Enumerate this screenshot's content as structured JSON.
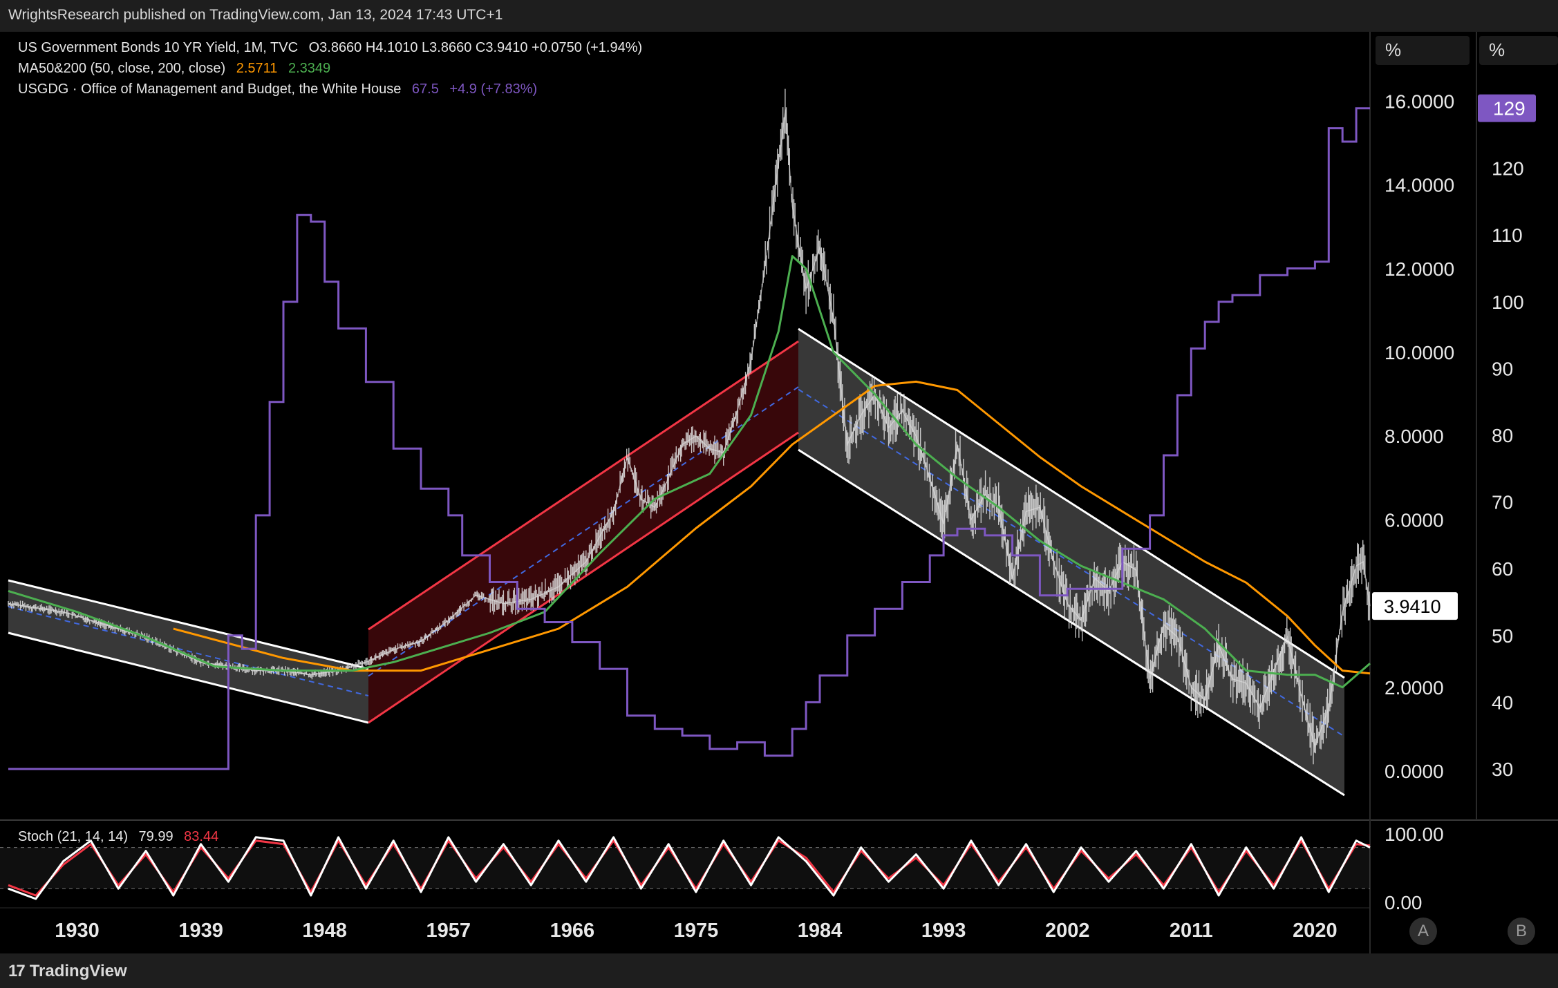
{
  "header": {
    "publisher": "WrightsResearch published on TradingView.com, Jan 13, 2024 17:43 UTC+1"
  },
  "legend": {
    "symbol": "US Government Bonds 10 YR Yield, 1M, TVC",
    "ohlc": "O3.8660   H4.1010   L3.8660   C3.9410   +0.0750 (+1.94%)",
    "ma_label": "MA50&200 (50, close, 200, close)",
    "ma50_value": "2.5711",
    "ma200_value": "2.3349",
    "debt_label": "USGDG · Office of Management and Budget, the White House",
    "debt_value": "67.5",
    "debt_change": "+4.9 (+7.83%)",
    "stoch_label": "Stoch (21, 14, 14)",
    "stoch_k": "79.99",
    "stoch_d": "83.44"
  },
  "price_scale": {
    "unit": "%",
    "ticks": [
      "16.0000",
      "14.0000",
      "12.0000",
      "10.0000",
      "8.0000",
      "6.0000",
      "2.0000",
      "0.0000"
    ],
    "last_price": "3.9410"
  },
  "debt_scale": {
    "unit": "%",
    "ticks": [
      "120",
      "110",
      "100",
      "90",
      "80",
      "70",
      "60",
      "50",
      "40",
      "30"
    ],
    "last_value": "129"
  },
  "stoch_scale": {
    "ticks": [
      "100.00",
      "0.00"
    ]
  },
  "time_axis": {
    "ticks": [
      "1930",
      "1939",
      "1948",
      "1957",
      "1966",
      "1975",
      "1984",
      "1993",
      "2002",
      "2011",
      "2020"
    ]
  },
  "buttons": {
    "a": "A",
    "b": "B"
  },
  "footer": {
    "brand": "TradingView"
  },
  "colors": {
    "debt": "#7e57c2",
    "ma50": "#4caf50",
    "ma200": "#ff9800",
    "price": "#e0e0e0",
    "channel_up": "#f23645",
    "channel_down": "#ffffff",
    "stoch_k": "#ffffff",
    "stoch_d": "#f23645"
  },
  "chart_data": [
    {
      "type": "line",
      "name": "US Government Bonds 10 YR Yield",
      "x": [
        1925,
        1927,
        1929,
        1931,
        1933,
        1935,
        1937,
        1939,
        1941,
        1943,
        1945,
        1947,
        1949,
        1951,
        1953,
        1955,
        1957,
        1959,
        1961,
        1963,
        1965,
        1967,
        1969,
        1970,
        1971,
        1972,
        1973,
        1974,
        1975,
        1976,
        1977,
        1978,
        1979,
        1980,
        1981,
        1981.5,
        1982,
        1983,
        1984,
        1985,
        1986,
        1987,
        1988,
        1989,
        1990,
        1991,
        1992,
        1993,
        1994,
        1995,
        1996,
        1997,
        1998,
        1999,
        2000,
        2001,
        2002,
        2003,
        2004,
        2005,
        2006,
        2007,
        2008,
        2009,
        2010,
        2011,
        2012,
        2013,
        2014,
        2015,
        2016,
        2017,
        2018,
        2019,
        2020,
        2021,
        2022,
        2023,
        2023.5,
        2024
      ],
      "y": [
        4.0,
        3.9,
        3.8,
        3.6,
        3.4,
        3.2,
        2.9,
        2.6,
        2.5,
        2.4,
        2.4,
        2.3,
        2.4,
        2.6,
        2.9,
        3.1,
        3.6,
        4.2,
        4.0,
        4.1,
        4.4,
        5.0,
        6.2,
        7.5,
        6.5,
        6.3,
        7.0,
        7.8,
        8.0,
        7.7,
        7.6,
        8.6,
        9.8,
        12.0,
        14.5,
        15.8,
        13.5,
        11.5,
        12.5,
        10.8,
        7.8,
        8.5,
        9.0,
        8.2,
        8.6,
        8.0,
        7.0,
        5.9,
        7.8,
        6.0,
        6.6,
        6.3,
        4.6,
        6.2,
        6.3,
        5.0,
        4.0,
        3.6,
        4.6,
        4.3,
        5.0,
        4.8,
        2.2,
        3.5,
        3.2,
        2.0,
        1.7,
        3.0,
        2.2,
        2.1,
        1.5,
        2.4,
        3.2,
        1.8,
        0.6,
        1.5,
        3.8,
        4.9,
        5.0,
        3.94
      ],
      "ylim": [
        0,
        16
      ]
    },
    {
      "type": "line",
      "name": "MA50",
      "x": [
        1925,
        1930,
        1935,
        1940,
        1945,
        1950,
        1953,
        1956,
        1960,
        1964,
        1968,
        1972,
        1976,
        1979,
        1981,
        1982,
        1983,
        1985,
        1988,
        1991,
        1994,
        1997,
        2000,
        2003,
        2006,
        2009,
        2012,
        2015,
        2018,
        2020,
        2022,
        2024
      ],
      "y": [
        4.3,
        3.8,
        3.2,
        2.5,
        2.4,
        2.4,
        2.6,
        2.9,
        3.3,
        3.8,
        5.2,
        6.5,
        7.1,
        8.5,
        10.5,
        12.3,
        12.0,
        10.0,
        9.0,
        7.8,
        7.0,
        6.3,
        5.5,
        4.9,
        4.5,
        4.1,
        3.4,
        2.4,
        2.3,
        2.3,
        2.0,
        2.57
      ],
      "ylim": [
        0,
        16
      ]
    },
    {
      "type": "line",
      "name": "MA200",
      "x": [
        1937,
        1945,
        1950,
        1955,
        1960,
        1965,
        1970,
        1975,
        1979,
        1982,
        1985,
        1988,
        1991,
        1994,
        1997,
        2000,
        2003,
        2006,
        2009,
        2012,
        2015,
        2018,
        2020,
        2022,
        2024
      ],
      "y": [
        3.4,
        2.7,
        2.4,
        2.4,
        2.9,
        3.4,
        4.4,
        5.8,
        6.8,
        7.8,
        8.5,
        9.2,
        9.3,
        9.1,
        8.3,
        7.5,
        6.8,
        6.2,
        5.6,
        5.0,
        4.5,
        3.7,
        3.0,
        2.4,
        2.33
      ],
      "ylim": [
        0,
        16
      ]
    },
    {
      "type": "line",
      "name": "USGDG",
      "x": [
        1925,
        1941,
        1942,
        1943,
        1944,
        1945,
        1946,
        1947,
        1948,
        1949,
        1951,
        1953,
        1955,
        1957,
        1958,
        1960,
        1962,
        1964,
        1966,
        1968,
        1970,
        1972,
        1974,
        1976,
        1978,
        1980,
        1981,
        1982,
        1983,
        1984,
        1986,
        1988,
        1990,
        1992,
        1993,
        1994,
        1996,
        1998,
        2000,
        2002,
        2004,
        2006,
        2008,
        2009,
        2010,
        2011,
        2012,
        2013,
        2014,
        2016,
        2018,
        2019,
        2020,
        2021,
        2022,
        2023
      ],
      "y": [
        30,
        50,
        48,
        68,
        85,
        100,
        113,
        112,
        103,
        96,
        88,
        78,
        72,
        68,
        62,
        58,
        54,
        52,
        49,
        45,
        38,
        36,
        35,
        33,
        34,
        32,
        32,
        36,
        40,
        44,
        50,
        54,
        58,
        62,
        65,
        66,
        65,
        62,
        56,
        57,
        57,
        63,
        68,
        77,
        86,
        93,
        97,
        100,
        101,
        104,
        105,
        105,
        106,
        126,
        124,
        129
      ],
      "ylim": [
        25,
        135
      ]
    },
    {
      "type": "line",
      "name": "Stoch",
      "x": [
        1925,
        1927,
        1929,
        1931,
        1933,
        1935,
        1937,
        1939,
        1941,
        1943,
        1945,
        1947,
        1949,
        1951,
        1953,
        1955,
        1957,
        1959,
        1961,
        1963,
        1965,
        1967,
        1969,
        1971,
        1973,
        1975,
        1977,
        1979,
        1981,
        1983,
        1985,
        1987,
        1989,
        1991,
        1993,
        1995,
        1997,
        1999,
        2001,
        2003,
        2005,
        2007,
        2009,
        2011,
        2013,
        2015,
        2017,
        2019,
        2021,
        2023,
        2024
      ],
      "k": [
        20,
        5,
        60,
        90,
        20,
        75,
        10,
        85,
        30,
        95,
        90,
        10,
        95,
        20,
        90,
        15,
        95,
        30,
        85,
        25,
        90,
        30,
        95,
        20,
        85,
        15,
        90,
        25,
        95,
        60,
        10,
        80,
        30,
        70,
        20,
        90,
        25,
        85,
        15,
        80,
        30,
        75,
        20,
        85,
        10,
        80,
        20,
        95,
        15,
        90,
        80
      ],
      "d": [
        25,
        10,
        55,
        85,
        25,
        70,
        15,
        80,
        35,
        90,
        85,
        15,
        90,
        25,
        85,
        20,
        90,
        35,
        80,
        30,
        85,
        35,
        90,
        25,
        80,
        20,
        85,
        30,
        90,
        65,
        15,
        75,
        35,
        65,
        25,
        85,
        30,
        80,
        20,
        75,
        35,
        70,
        25,
        80,
        15,
        75,
        25,
        90,
        20,
        85,
        83
      ],
      "ylim": [
        0,
        100
      ]
    }
  ]
}
